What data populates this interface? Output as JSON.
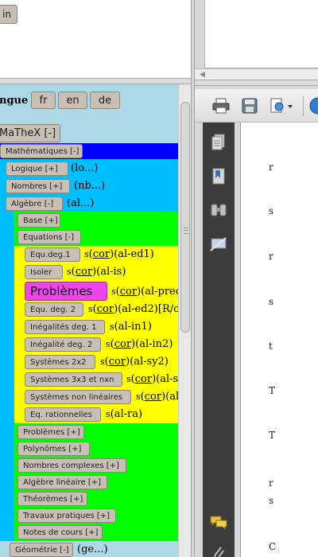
{
  "top_button": "in",
  "langue": {
    "label": "ngue",
    "options": [
      "fr",
      "en",
      "de"
    ]
  },
  "mathex_button": "MaTheX [-]",
  "mathematiques_button": "Mathématiques [-]",
  "sections": {
    "logique": {
      "button": "Logique [+]",
      "label": "(lo...)"
    },
    "nombres": {
      "button": "Nombres [+]",
      "label": "(nb...)"
    },
    "algebre": {
      "button": "Algèbre [-]",
      "label": "(al...)"
    },
    "base": {
      "button": "Base [+]"
    },
    "equations": {
      "button": "Equations [-]"
    },
    "geometrie": {
      "button": "Géométrie [-]",
      "label": "(ge...)"
    }
  },
  "equations_items": [
    {
      "button": "Equ.deg.1",
      "s": "s",
      "cor": "cor",
      "code": "(al-ed1)"
    },
    {
      "button": "Isoler",
      "s": "s",
      "cor": "cor",
      "code": "(al-is)"
    },
    {
      "button": "Problèmes",
      "s": "s",
      "cor": "cor",
      "code": "(al-prec"
    },
    {
      "button": "Equ. deg. 2",
      "s": "s",
      "cor": "cor",
      "code": "(al-ed2)[R/c"
    },
    {
      "button": "Inégalités deg. 1",
      "s": "s",
      "cor": "",
      "code": "(al-in1)"
    },
    {
      "button": "Inégalité deg. 2",
      "s": "s",
      "cor": "cor",
      "code": "(al-in2)"
    },
    {
      "button": "Systèmes 2x2",
      "s": "s",
      "cor": "cor",
      "code": "(al-sy2)"
    },
    {
      "button": "Systèmes 3x3 et nxn",
      "s": "s",
      "cor": "cor",
      "code": "(al-s"
    },
    {
      "button": "Systèmes non linéaires",
      "s": "s",
      "cor": "cor",
      "code": "(al"
    },
    {
      "button": "Eq. rationnelles",
      "s": "s",
      "cor": "",
      "code": "(al-ra)"
    }
  ],
  "algebre_items": [
    "Problèmes [+]",
    "Polynômes [+]",
    "Nombres complexes [+]",
    "Algèbre linéaire [+]",
    "Théorèmes [+]",
    "Travaux pratiques [+]",
    "Notes de cours [+]"
  ],
  "pdf_page_chars": [
    "r",
    "s",
    "r",
    "s",
    "t",
    "T",
    "T",
    "r",
    "s",
    "C"
  ],
  "colors": {
    "frame_bg": "#add8e6",
    "mathematiques_band": "#0000ff",
    "algebre_band": "#00bfff",
    "equations_band": "#00ff00",
    "items_band": "#ffff00",
    "highlight_button": "#ee44ee",
    "button_bg": "#c8bfb5"
  },
  "icons": [
    "print-icon",
    "save-icon",
    "document-properties-icon",
    "globe-icon",
    "pages-icon",
    "bookmarks-icon",
    "binoculars-icon",
    "signature-icon",
    "comments-icon",
    "attachment-icon"
  ]
}
